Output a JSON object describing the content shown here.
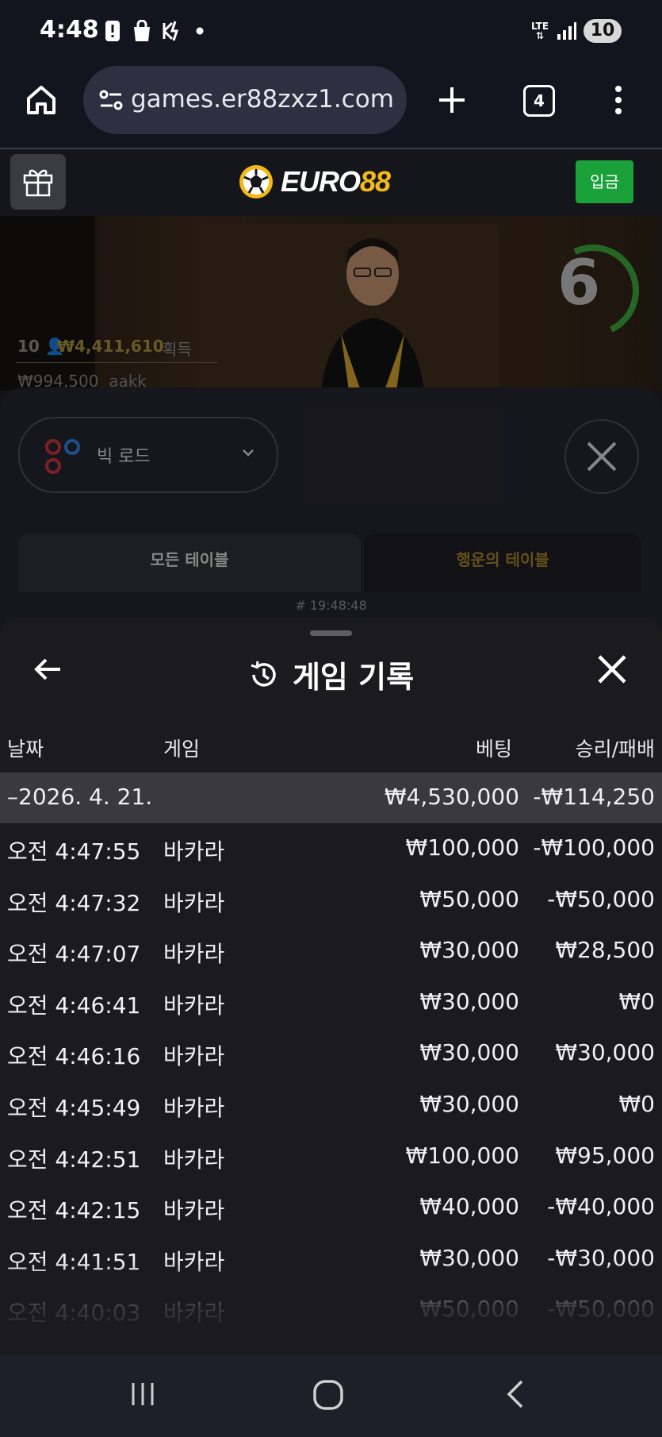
{
  "status_bar": {
    "time": "4:48",
    "network": "LTE",
    "battery": "10",
    "icons": [
      "alert-icon",
      "shopping-bag-icon",
      "no-call-icon",
      "dot-icon",
      "lte-icon",
      "signal-icon"
    ]
  },
  "browser": {
    "url": "games.er88zxz1.com",
    "tab_count": "4",
    "icons": [
      "home-icon",
      "site-settings-icon",
      "new-tab-icon",
      "tab-switcher-icon",
      "more-menu-icon"
    ]
  },
  "site": {
    "brand_primary": "EURO",
    "brand_accent": "88",
    "deposit_label": "입금",
    "colors": {
      "brand_gold": "#f3b917",
      "deposit_green": "#1aa13a"
    }
  },
  "video": {
    "timer": "6",
    "player_count": "10",
    "win_amount": "₩4,411,610",
    "win_label": "획득",
    "bet_amount": "₩994,500",
    "bet_user": "aakk"
  },
  "lobby": {
    "road_label": "빅 로드",
    "tab_all": "모든 테이블",
    "tab_lucky": "행운의 테이블",
    "round_id": "# 19:48:48"
  },
  "history": {
    "title": "게임 기록",
    "columns": {
      "date": "날짜",
      "game": "게임",
      "bet": "베팅",
      "result": "승리/패배"
    },
    "date_group": {
      "date": "–2026. 4. 21.",
      "bet": "₩4,530,000",
      "result": "-₩114,250"
    },
    "rows": [
      {
        "time": "오전 4:47:55",
        "game": "바카라",
        "bet": "₩100,000",
        "result": "-₩100,000"
      },
      {
        "time": "오전 4:47:32",
        "game": "바카라",
        "bet": "₩50,000",
        "result": "-₩50,000"
      },
      {
        "time": "오전 4:47:07",
        "game": "바카라",
        "bet": "₩30,000",
        "result": "₩28,500"
      },
      {
        "time": "오전 4:46:41",
        "game": "바카라",
        "bet": "₩30,000",
        "result": "₩0"
      },
      {
        "time": "오전 4:46:16",
        "game": "바카라",
        "bet": "₩30,000",
        "result": "₩30,000"
      },
      {
        "time": "오전 4:45:49",
        "game": "바카라",
        "bet": "₩30,000",
        "result": "₩0"
      },
      {
        "time": "오전 4:42:51",
        "game": "바카라",
        "bet": "₩100,000",
        "result": "₩95,000"
      },
      {
        "time": "오전 4:42:15",
        "game": "바카라",
        "bet": "₩40,000",
        "result": "-₩40,000"
      },
      {
        "time": "오전 4:41:51",
        "game": "바카라",
        "bet": "₩30,000",
        "result": "-₩30,000"
      },
      {
        "time": "오전 4:40:03",
        "game": "바카라",
        "bet": "₩50,000",
        "result": "-₩50,000"
      }
    ]
  },
  "nav_bar": {
    "icons": [
      "recent-apps-icon",
      "home-button-icon",
      "back-icon"
    ]
  }
}
